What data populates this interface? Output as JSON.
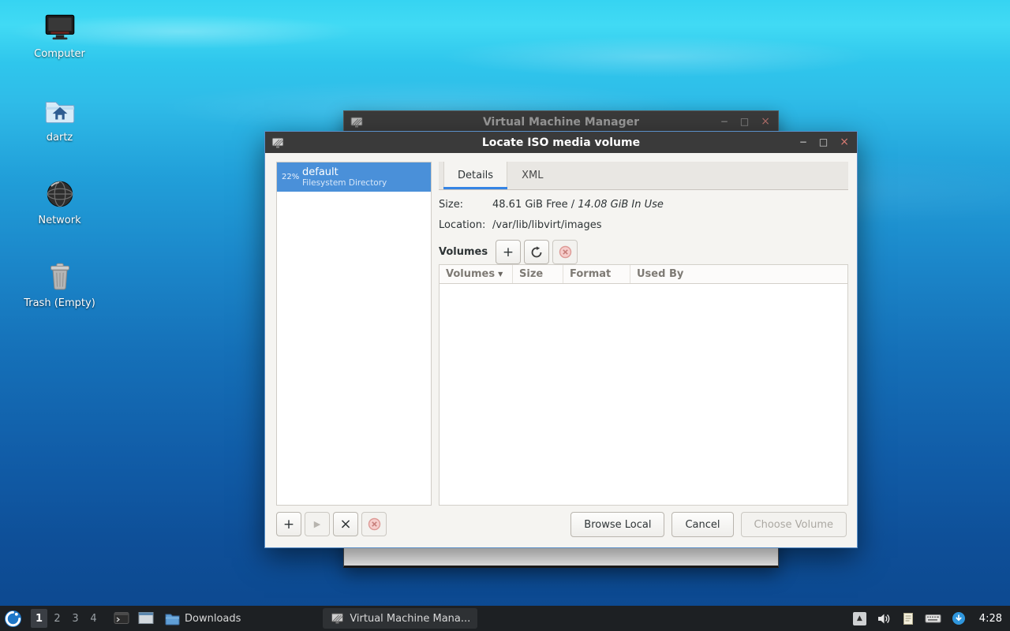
{
  "desktop": {
    "icons": [
      {
        "label": "Computer"
      },
      {
        "label": "dartz"
      },
      {
        "label": "Network"
      },
      {
        "label": "Trash (Empty)"
      }
    ]
  },
  "background_window": {
    "title": "Virtual Machine Manager"
  },
  "dialog": {
    "title": "Locate ISO media volume",
    "pools": [
      {
        "percent": "22%",
        "name": "default",
        "type": "Filesystem Directory"
      }
    ],
    "tabs": [
      {
        "label": "Details"
      },
      {
        "label": "XML"
      }
    ],
    "details": {
      "size_label": "Size:",
      "size_free": "48.61 GiB Free / ",
      "size_used": "14.08 GiB In Use",
      "location_label": "Location:",
      "location_value": "/var/lib/libvirt/images",
      "volumes_label": "Volumes"
    },
    "table": {
      "headers": [
        "Volumes",
        "Size",
        "Format",
        "Used By"
      ]
    },
    "buttons": {
      "browse_local": "Browse Local",
      "cancel": "Cancel",
      "choose_volume": "Choose Volume"
    }
  },
  "taskbar": {
    "workspaces": [
      "1",
      "2",
      "3",
      "4"
    ],
    "downloads_label": "Downloads",
    "task_label": "Virtual Machine Mana...",
    "clock": "4:28"
  },
  "glyphs": {
    "minimize": "−",
    "restore": "□",
    "close": "×",
    "plus": "+",
    "play": "▶",
    "delete": "×",
    "sort": "▼",
    "tray_arrow": "▲"
  },
  "colors": {
    "selection": "#4a90d9",
    "tab_underline": "#3584e4",
    "titlebar": "#3a3a3a"
  }
}
